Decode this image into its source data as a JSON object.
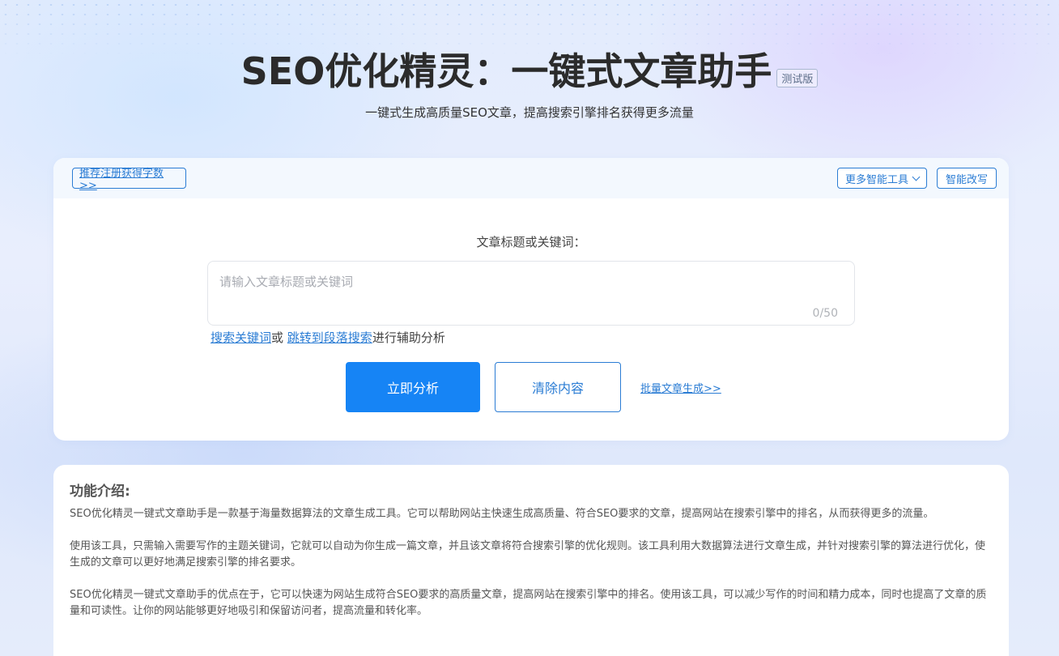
{
  "hero": {
    "title": "SEO优化精灵：一键式文章助手",
    "badge": "测试版",
    "subtitle": "一键式生成高质量SEO文章，提高搜索引擎排名获得更多流量"
  },
  "toolbar": {
    "register_label": "推荐注册获得字数>>",
    "more_tools_label": "更多智能工具",
    "rewrite_label": "智能改写"
  },
  "form": {
    "label": "文章标题或关键词：",
    "placeholder": "请输入文章标题或关键词",
    "value": "",
    "char_count": "0/50",
    "assist": {
      "link1": "搜索关键词",
      "or": "或 ",
      "link2": "跳转到段落搜索",
      "suffix": "进行辅助分析"
    },
    "analyze_label": "立即分析",
    "clear_label": "清除内容",
    "batch_label": "批量文章生成>>"
  },
  "intro": {
    "title": "功能介绍:",
    "paragraphs": [
      "SEO优化精灵一键式文章助手是一款基于海量数据算法的文章生成工具。它可以帮助网站主快速生成高质量、符合SEO要求的文章，提高网站在搜索引擎中的排名，从而获得更多的流量。",
      "使用该工具，只需输入需要写作的主题关键词，它就可以自动为你生成一篇文章，并且该文章将符合搜索引擎的优化规则。该工具利用大数据算法进行文章生成，并针对搜索引擎的算法进行优化，使生成的文章可以更好地满足搜索引擎的排名要求。",
      "SEO优化精灵一键式文章助手的优点在于，它可以快速为网站生成符合SEO要求的高质量文章，提高网站在搜索引擎中的排名。使用该工具，可以减少写作的时间和精力成本，同时也提高了文章的质量和可读性。让你的网站能够更好地吸引和保留访问者，提高流量和转化率。"
    ]
  },
  "colors": {
    "primary": "#1684f5",
    "link": "#2a7cd4"
  }
}
